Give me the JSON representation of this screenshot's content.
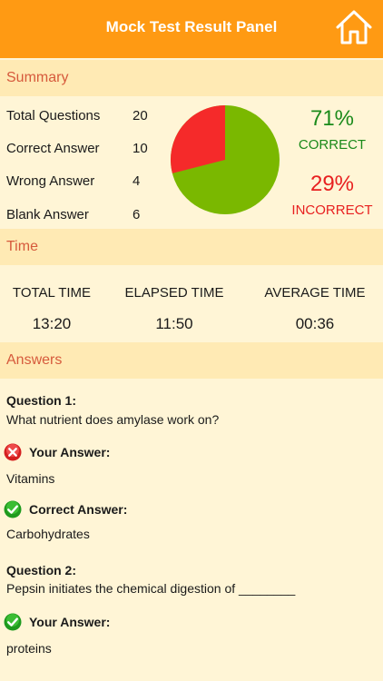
{
  "header": {
    "title": "Mock Test Result Panel",
    "home_icon": "home-icon"
  },
  "summary": {
    "section_label": "Summary",
    "rows": [
      {
        "label": "Total Questions",
        "value": "20"
      },
      {
        "label": "Correct Answer",
        "value": "10"
      },
      {
        "label": "Wrong Answer",
        "value": "4"
      },
      {
        "label": "Blank Answer",
        "value": "6"
      }
    ],
    "correct_percent": "71%",
    "correct_label": "CORRECT",
    "incorrect_percent": "29%",
    "incorrect_label": "INCORRECT",
    "correct_fraction": 0.71,
    "colors": {
      "correct": "#7ab800",
      "incorrect": "#f52a2a"
    }
  },
  "time": {
    "section_label": "Time",
    "total_label": "TOTAL TIME",
    "total_value": "13:20",
    "elapsed_label": "ELAPSED TIME",
    "elapsed_value": "11:50",
    "average_label": "AVERAGE TIME",
    "average_value": "00:36"
  },
  "answers": {
    "section_label": "Answers",
    "questions": [
      {
        "title": "Question 1:",
        "text": "What nutrient does amylase work on?",
        "your_answer_label": "Your Answer:",
        "your_answer": "Vitamins",
        "your_answer_icon": "wrong-icon",
        "correct_answer_label": "Correct Answer:",
        "correct_answer": "Carbohydrates",
        "correct_answer_icon": "check-icon"
      },
      {
        "title": "Question 2:",
        "text": "Pepsin initiates the chemical digestion of ________",
        "your_answer_label": "Your Answer:",
        "your_answer": "proteins",
        "your_answer_icon": "check-icon"
      }
    ]
  }
}
